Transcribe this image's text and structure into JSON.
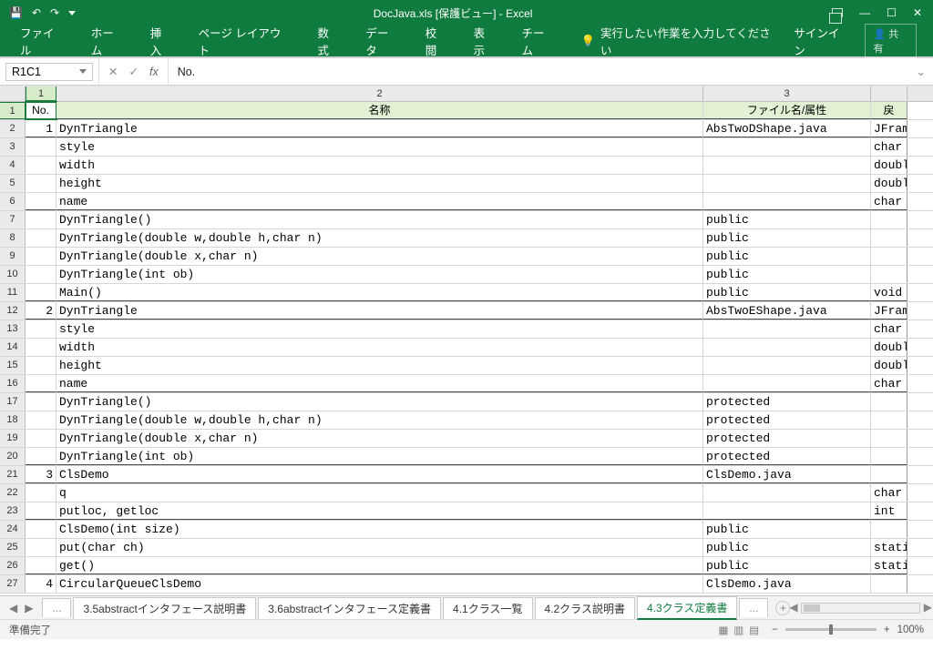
{
  "title": "DocJava.xls  [保護ビュー] - Excel",
  "ribbon": {
    "file": "ファイル",
    "home": "ホーム",
    "insert": "挿入",
    "layout": "ページ レイアウト",
    "formulas": "数式",
    "data": "データ",
    "review": "校閲",
    "view": "表示",
    "team": "チーム",
    "tellme": "実行したい作業を入力してください",
    "signin": "サインイン",
    "share": "共有"
  },
  "nameBox": "R1C1",
  "formula": "No.",
  "colHeaders": {
    "a": "1",
    "b": "2",
    "c": "3"
  },
  "headers": {
    "no": "No.",
    "name": "名称",
    "file": "ファイル名/属性",
    "ret": "戻"
  },
  "rows": [
    {
      "r": 2,
      "no": "1",
      "b": "DynTriangle",
      "c": "AbsTwoDShape.java",
      "d": "JFram",
      "bb": true
    },
    {
      "r": 3,
      "b": "style",
      "d": "char"
    },
    {
      "r": 4,
      "b": "width",
      "d": "doubl"
    },
    {
      "r": 5,
      "b": "height",
      "d": "doubl"
    },
    {
      "r": 6,
      "b": "name",
      "d": "char",
      "bb": true
    },
    {
      "r": 7,
      "b": "DynTriangle()",
      "c": "public"
    },
    {
      "r": 8,
      "b": "DynTriangle(double w,double h,char n)",
      "c": "public"
    },
    {
      "r": 9,
      "b": "DynTriangle(double x,char n)",
      "c": "public"
    },
    {
      "r": 10,
      "b": "DynTriangle(int ob)",
      "c": "public"
    },
    {
      "r": 11,
      "b": "Main()",
      "c": "public",
      "d": "void",
      "bb": true
    },
    {
      "r": 12,
      "no": "2",
      "b": "DynTriangle",
      "c": "AbsTwoEShape.java",
      "d": "JFram",
      "bb": true
    },
    {
      "r": 13,
      "b": "style",
      "d": "char"
    },
    {
      "r": 14,
      "b": "width",
      "d": "doubl"
    },
    {
      "r": 15,
      "b": "height",
      "d": "doubl"
    },
    {
      "r": 16,
      "b": "name",
      "d": "char",
      "bb": true
    },
    {
      "r": 17,
      "b": "DynTriangle()",
      "c": "protected"
    },
    {
      "r": 18,
      "b": "DynTriangle(double w,double h,char n)",
      "c": "protected"
    },
    {
      "r": 19,
      "b": "DynTriangle(double x,char n)",
      "c": "protected"
    },
    {
      "r": 20,
      "b": "DynTriangle(int ob)",
      "c": "protected",
      "bb": true
    },
    {
      "r": 21,
      "no": "3",
      "b": "ClsDemo",
      "c": "ClsDemo.java",
      "bb": true
    },
    {
      "r": 22,
      "b": "q",
      "d": "char"
    },
    {
      "r": 23,
      "b": "putloc, getloc",
      "d": "int",
      "bb": true
    },
    {
      "r": 24,
      "b": "ClsDemo(int size)",
      "c": "public"
    },
    {
      "r": 25,
      "b": "put(char ch)",
      "c": "public",
      "d": "stati"
    },
    {
      "r": 26,
      "b": "get()",
      "c": "public",
      "d": "stati",
      "bb": true
    },
    {
      "r": 27,
      "no": "4",
      "b": "CircularQueueClsDemo",
      "c": "ClsDemo.java"
    }
  ],
  "tabs": {
    "ellipsis": "...",
    "t1": "3.5abstractインタフェース説明書",
    "t2": "3.6abstractインタフェース定義書",
    "t3": "4.1クラス一覧",
    "t4": "4.2クラス説明書",
    "t5": "4.3クラス定義書"
  },
  "status": {
    "ready": "準備完了",
    "zoom": "100%"
  }
}
